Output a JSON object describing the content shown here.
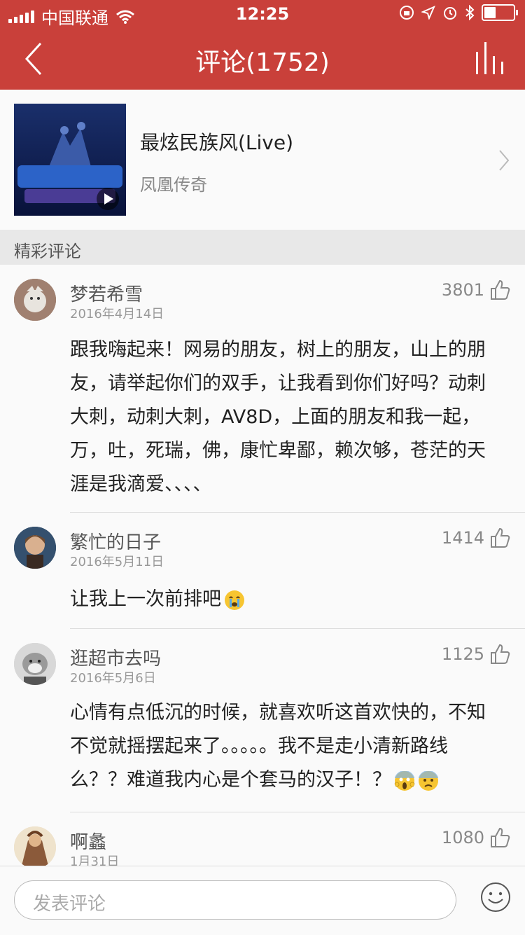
{
  "status": {
    "carrier": "中国联通",
    "time": "12:25"
  },
  "nav": {
    "title": "评论(1752)"
  },
  "song": {
    "name": "最炫民族风(Live)",
    "artist": "凤凰传奇"
  },
  "section": {
    "title": "精彩评论"
  },
  "comments": [
    {
      "user": "梦若希雪",
      "date": "2016年4月14日",
      "likes": "3801",
      "text": "跟我嗨起来！网易的朋友，树上的朋友，山上的朋友，请举起你们的双手，让我看到你们好吗？动刺大刺，动刺大刺，AV8D，上面的朋友和我一起，万，吐，死瑞，佛，康忙卑鄙，赖次够，苍茫的天涯是我滴爱、、、、"
    },
    {
      "user": "繁忙的日子",
      "date": "2016年5月11日",
      "likes": "1414",
      "text": "让我上一次前排吧"
    },
    {
      "user": "逛超市去吗",
      "date": "2016年5月6日",
      "likes": "1125",
      "text": "心情有点低沉的时候，就喜欢听这首欢快的，不知不觉就摇摆起来了。。。。。我不是走小清新路线么？？难道我内心是个套马的汉子！？"
    },
    {
      "user": "啊蠡",
      "date": "1月31日",
      "likes": "1080",
      "text": ""
    }
  ],
  "input": {
    "placeholder": "发表评论"
  },
  "colors": {
    "brand": "#c9403a"
  }
}
